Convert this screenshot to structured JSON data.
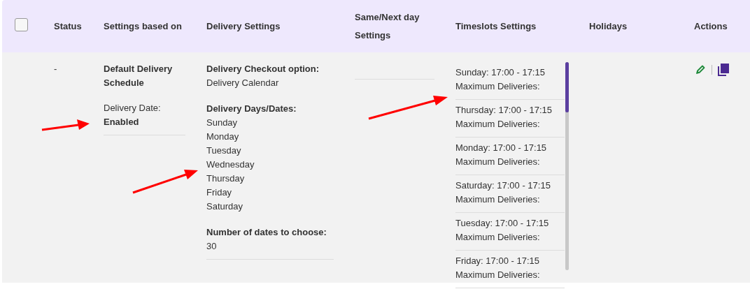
{
  "table": {
    "select_all": {
      "checked": false
    },
    "columns": [
      "Status",
      "Settings based on",
      "Delivery Settings",
      "Same/Next day Settings",
      "Timeslots Settings",
      "Holidays",
      "Actions"
    ],
    "rows": [
      {
        "status": "-",
        "settings_based_on": {
          "title": "Default Delivery Schedule",
          "label": "Delivery Date:",
          "value": "Enabled"
        },
        "delivery_settings": [
          {
            "label": "Delivery Checkout option:",
            "values": [
              "Delivery Calendar"
            ]
          },
          {
            "label": "Delivery Days/Dates:",
            "values": [
              "Sunday",
              "Monday",
              "Tuesday",
              "Wednesday",
              "Thursday",
              "Friday",
              "Saturday"
            ]
          },
          {
            "label": "Number of dates to choose:",
            "values": [
              "30"
            ]
          }
        ],
        "timeslots": [
          {
            "slot": "Sunday: 17:00 - 17:15",
            "max": "Maximum Deliveries:"
          },
          {
            "slot": "Thursday: 17:00 - 17:15",
            "max": "Maximum Deliveries:"
          },
          {
            "slot": "Monday: 17:00 - 17:15",
            "max": "Maximum Deliveries:"
          },
          {
            "slot": "Saturday: 17:00 - 17:15",
            "max": "Maximum Deliveries:"
          },
          {
            "slot": "Tuesday: 17:00 - 17:15",
            "max": "Maximum Deliveries:"
          },
          {
            "slot": "Friday: 17:00 - 17:15",
            "max": "Maximum Deliveries:"
          }
        ]
      }
    ]
  }
}
